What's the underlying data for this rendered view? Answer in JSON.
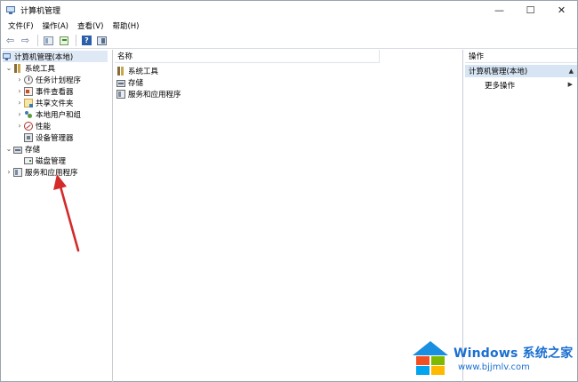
{
  "window": {
    "title": "计算机管理",
    "controls": {
      "minimize": "—",
      "maximize": "☐",
      "close": "✕"
    }
  },
  "menu": [
    "文件(F)",
    "操作(A)",
    "查看(V)",
    "帮助(H)"
  ],
  "toolbar": {
    "back": "⇦",
    "forward": "⇨",
    "help": "?"
  },
  "tree": {
    "root": "计算机管理(本地)",
    "system_tools": "系统工具",
    "task_scheduler": "任务计划程序",
    "event_viewer": "事件查看器",
    "shared_folders": "共享文件夹",
    "local_users": "本地用户和组",
    "performance": "性能",
    "device_manager": "设备管理器",
    "storage": "存储",
    "disk_management": "磁盘管理",
    "services_apps": "服务和应用程序",
    "expanded": "⌄",
    "collapsed": "›"
  },
  "list": {
    "header": "名称",
    "items": [
      "系统工具",
      "存储",
      "服务和应用程序"
    ]
  },
  "actions": {
    "header": "操作",
    "section": "计算机管理(本地)",
    "more": "更多操作",
    "tri_up": "▲",
    "tri_right": "▶"
  },
  "watermark": {
    "brand": "Windows",
    "name": "系统之家",
    "url": "www.bjjmlv.com"
  },
  "colors": {
    "selection": "#dfe9f5",
    "action_header": "#d6e4f3",
    "annotation_arrow": "#d42a2a",
    "watermark_blue": "#1a6fd1"
  }
}
